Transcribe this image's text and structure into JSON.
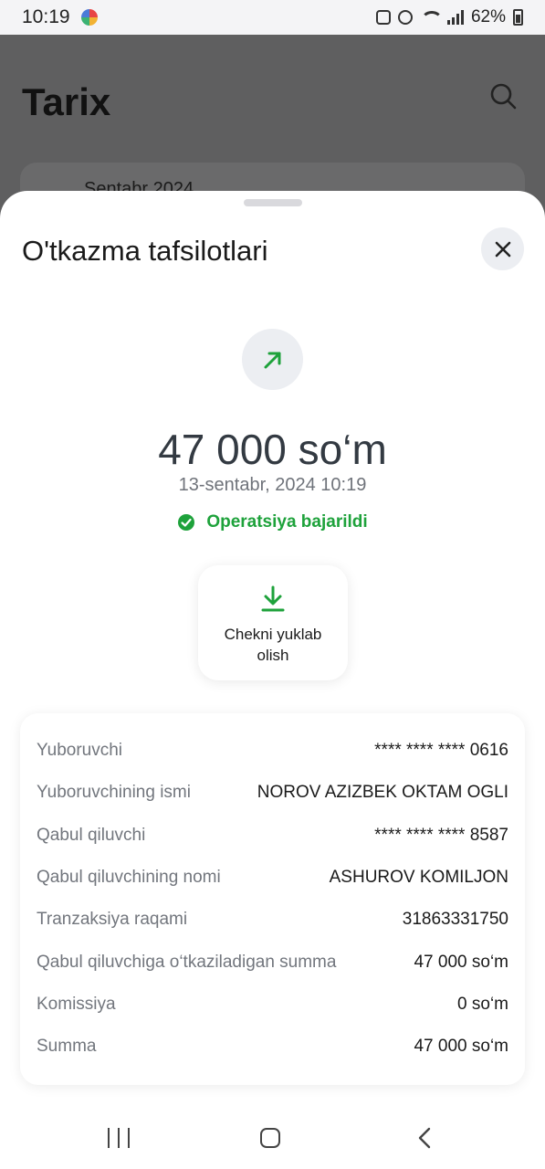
{
  "status_bar": {
    "time": "10:19",
    "battery": "62%",
    "icons": [
      "app-icon",
      "lock-icon",
      "alarm-icon",
      "wifi-icon",
      "signal-icon",
      "battery-icon"
    ]
  },
  "background_page": {
    "title": "Tarix",
    "filter_label": "Sentabr 2024"
  },
  "sheet": {
    "title": "O'tkazma tafsilotlari",
    "amount": "47 000 so‘m",
    "date": "13-sentabr, 2024 10:19",
    "status": "Operatsiya bajarildi",
    "download_label": "Chekni yuklab olish",
    "details": [
      {
        "label": "Yuboruvchi",
        "value": "**** **** **** 0616"
      },
      {
        "label": "Yuboruvchining ismi",
        "value": "NOROV AZIZBEK OKTAM OGLI"
      },
      {
        "label": "Qabul qiluvchi",
        "value": "**** **** **** 8587"
      },
      {
        "label": "Qabul qiluvchining nomi",
        "value": "ASHUROV KOMILJON"
      },
      {
        "label": "Tranzaksiya raqami",
        "value": "31863331750"
      },
      {
        "label": "Qabul qiluvchiga o‘tkaziladigan summa",
        "value": "47 000 so‘m"
      },
      {
        "label": "Komissiya",
        "value": "0 so‘m"
      },
      {
        "label": "Summa",
        "value": "47 000 so‘m"
      }
    ]
  },
  "colors": {
    "accent_green": "#1ea23b",
    "overlay": "#5f5f60",
    "icon_bg": "#eceef2"
  }
}
